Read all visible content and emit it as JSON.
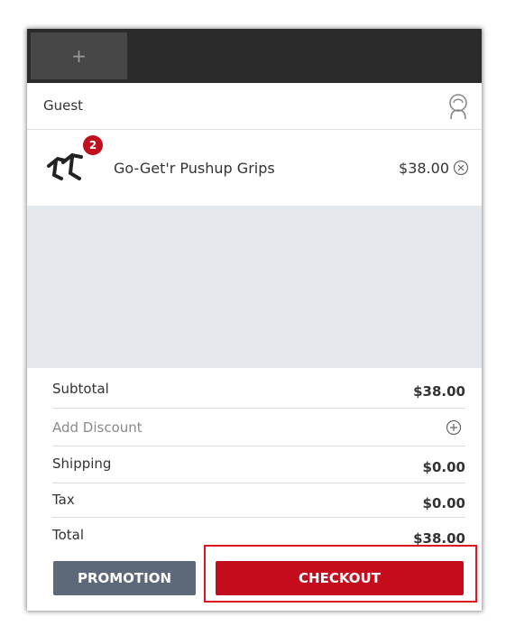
{
  "topbar": {
    "add_tab_label": "+"
  },
  "customer": {
    "name": "Guest"
  },
  "cart": {
    "items": [
      {
        "name": "Go-Get'r Pushup Grips",
        "price": "$38.00",
        "quantity": "2"
      }
    ]
  },
  "summary": {
    "subtotal_label": "Subtotal",
    "subtotal_value": "$38.00",
    "discount_label": "Add Discount",
    "shipping_label": "Shipping",
    "shipping_value": "$0.00",
    "tax_label": "Tax",
    "tax_value": "$0.00",
    "total_label": "Total",
    "total_value": "$38.00"
  },
  "actions": {
    "promotion_label": "PROMOTION",
    "checkout_label": "CHECKOUT"
  },
  "colors": {
    "topbar": "#2b2b2b",
    "checkout": "#c40c1c",
    "promotion": "#5d6879",
    "highlight": "#e0151f",
    "badge": "#c0101e"
  }
}
